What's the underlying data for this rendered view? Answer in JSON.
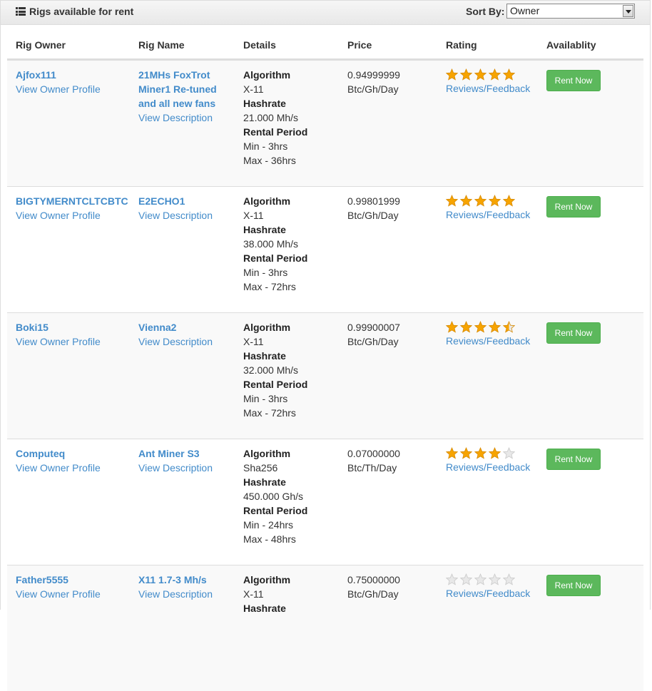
{
  "header": {
    "title": "Rigs available for rent",
    "sort_label": "Sort By:",
    "sort_value": "Owner"
  },
  "columns": [
    "Rig Owner",
    "Rig Name",
    "Details",
    "Price",
    "Rating",
    "Availablity"
  ],
  "labels": {
    "owner_profile": "View Owner Profile",
    "description": "View Description",
    "algorithm": "Algorithm",
    "hashrate": "Hashrate",
    "rental_period": "Rental Period",
    "reviews": "Reviews/Feedback",
    "rent_now": "Rent Now"
  },
  "colors": {
    "link": "#428bca",
    "button": "#5cb85c",
    "star_on": "#f7a400",
    "star_off": "#e8e8e8"
  },
  "rigs": [
    {
      "owner": "Ajfox111",
      "rig_name": [
        "21MHs FoxTrot",
        "Miner1 Re-tuned",
        "and all new fans"
      ],
      "algorithm": "X-11",
      "hashrate": "21.000 Mh/s",
      "min": "Min - 3hrs",
      "max": "Max - 36hrs",
      "price": "0.94999999",
      "price_unit": "Btc/Gh/Day",
      "rating": 5
    },
    {
      "owner": "BIGTYMERNTCLTCBTC",
      "rig_name": [
        "E2ECHO1"
      ],
      "algorithm": "X-11",
      "hashrate": "38.000 Mh/s",
      "min": "Min - 3hrs",
      "max": "Max - 72hrs",
      "price": "0.99801999",
      "price_unit": "Btc/Gh/Day",
      "rating": 5
    },
    {
      "owner": "Boki15",
      "rig_name": [
        "Vienna2"
      ],
      "algorithm": "X-11",
      "hashrate": "32.000 Mh/s",
      "min": "Min - 3hrs",
      "max": "Max - 72hrs",
      "price": "0.99900007",
      "price_unit": "Btc/Gh/Day",
      "rating": 4.5
    },
    {
      "owner": "Computeq",
      "rig_name": [
        "Ant Miner S3"
      ],
      "algorithm": "Sha256",
      "hashrate": "450.000 Gh/s",
      "min": "Min - 24hrs",
      "max": "Max - 48hrs",
      "price": "0.07000000",
      "price_unit": "Btc/Th/Day",
      "rating": 4
    },
    {
      "owner": "Father5555",
      "rig_name": [
        "X11 1.7-3 Mh/s"
      ],
      "algorithm": "X-11",
      "hashrate": "",
      "min": "",
      "max": "",
      "price": "0.75000000",
      "price_unit": "Btc/Gh/Day",
      "rating": 0
    }
  ]
}
